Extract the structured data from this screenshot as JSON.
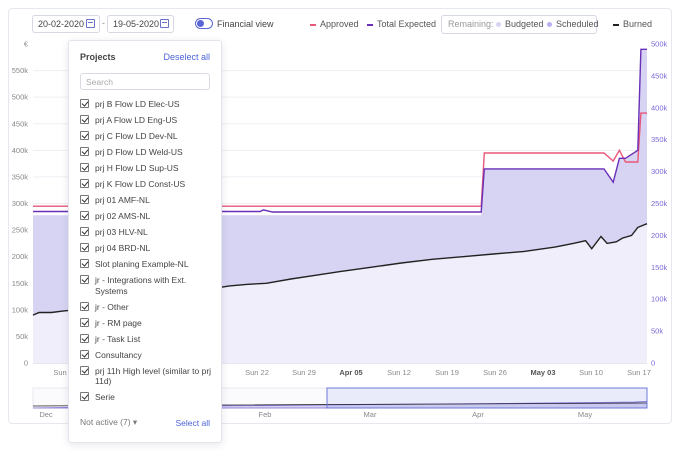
{
  "toolbar": {
    "date_from": "20-02-2020",
    "date_to": "19-05-2020",
    "date_separator": "-",
    "financial_view_label": "Financial view",
    "financial_view_on": true
  },
  "legend": {
    "approved": "Approved",
    "total_expected": "Total Expected",
    "remaining_label": "Remaining:",
    "budgeted": "Budgeted",
    "scheduled": "Scheduled",
    "burned": "Burned"
  },
  "colors": {
    "approved": "#e8587a",
    "total_expected": "#6a2fb8",
    "budgeted_area": "#d7d4f3",
    "scheduled_area": "#b8b0ef",
    "burned": "#222222",
    "accent": "#4b63d8"
  },
  "panel": {
    "title": "Projects",
    "deselect_all": "Deselect all",
    "search_placeholder": "Search",
    "items": [
      "prj B Flow LD Elec-US",
      "prj A Flow LD Eng-US",
      "prj C Flow LD Dev-NL",
      "prj D Flow LD Weld-US",
      "prj H Flow LD Sup-US",
      "prj K Flow LD Const-US",
      "prj 01 AMF-NL",
      "prj 02 AMS-NL",
      "prj 03 HLV-NL",
      "prj 04 BRD-NL",
      "Slot planing Example-NL",
      "jr - Integrations with Ext. Systems",
      "jr - Other",
      "jr - RM page",
      "jr - Task List",
      "Consultancy",
      "prj 11h High level (similar to prj 11d)",
      "Serie"
    ],
    "not_active": "Not active (7)",
    "select_all": "Select all"
  },
  "chart_data": {
    "type": "area",
    "y_unit_label": "€",
    "y_ticks": [
      "0",
      "50k",
      "100k",
      "150k",
      "200k",
      "250k",
      "300k",
      "350k",
      "400k",
      "450k",
      "500k",
      "550k"
    ],
    "y_ticks_right": [
      "0",
      "50k",
      "100k",
      "150k",
      "200k",
      "250k",
      "300k",
      "350k",
      "400k",
      "450k",
      "500k"
    ],
    "ylim": [
      0,
      600000
    ],
    "x_ticks": [
      {
        "label": "Sun",
        "bold": false
      },
      {
        "label": "Sun 22",
        "bold": false
      },
      {
        "label": "Sun 29",
        "bold": false
      },
      {
        "label": "Apr 05",
        "bold": true
      },
      {
        "label": "Sun 12",
        "bold": false
      },
      {
        "label": "Sun 19",
        "bold": false
      },
      {
        "label": "Sun 26",
        "bold": false
      },
      {
        "label": "May 03",
        "bold": true
      },
      {
        "label": "Sun 10",
        "bold": false
      },
      {
        "label": "Sun 17",
        "bold": false
      }
    ],
    "navigator_labels": [
      "Dec",
      "Feb",
      "Mar",
      "Apr",
      "May"
    ],
    "series": [
      {
        "name": "Approved",
        "kind": "line",
        "points": [
          [
            0,
            295000
          ],
          [
            0.73,
            295000
          ],
          [
            0.735,
            395000
          ],
          [
            0.93,
            395000
          ],
          [
            0.945,
            380000
          ],
          [
            0.955,
            400000
          ],
          [
            0.965,
            378000
          ],
          [
            0.985,
            378000
          ],
          [
            0.99,
            470000
          ],
          [
            1,
            470000
          ]
        ]
      },
      {
        "name": "Total Expected",
        "kind": "line",
        "points": [
          [
            0,
            285000
          ],
          [
            0.37,
            285000
          ],
          [
            0.375,
            288000
          ],
          [
            0.39,
            284000
          ],
          [
            0.73,
            284000
          ],
          [
            0.735,
            365000
          ],
          [
            0.93,
            365000
          ],
          [
            0.945,
            340000
          ],
          [
            0.955,
            385000
          ],
          [
            0.965,
            385000
          ],
          [
            0.985,
            400000
          ],
          [
            0.99,
            590000
          ],
          [
            1,
            590000
          ]
        ]
      },
      {
        "name": "Budgeted",
        "kind": "area",
        "points": [
          [
            0,
            278000
          ],
          [
            0.73,
            278000
          ],
          [
            0.735,
            365000
          ],
          [
            0.93,
            365000
          ],
          [
            0.945,
            340000
          ],
          [
            0.955,
            385000
          ],
          [
            0.965,
            385000
          ],
          [
            0.985,
            400000
          ],
          [
            0.99,
            590000
          ],
          [
            1,
            590000
          ]
        ]
      },
      {
        "name": "Burned",
        "kind": "line",
        "points": [
          [
            0,
            90000
          ],
          [
            0.01,
            95000
          ],
          [
            0.03,
            95000
          ],
          [
            0.05,
            98000
          ],
          [
            0.07,
            100000
          ],
          [
            0.32,
            145000
          ],
          [
            0.35,
            148000
          ],
          [
            0.38,
            150000
          ],
          [
            0.42,
            158000
          ],
          [
            0.46,
            165000
          ],
          [
            0.5,
            172000
          ],
          [
            0.55,
            180000
          ],
          [
            0.6,
            188000
          ],
          [
            0.65,
            195000
          ],
          [
            0.7,
            200000
          ],
          [
            0.75,
            205000
          ],
          [
            0.8,
            210000
          ],
          [
            0.85,
            218000
          ],
          [
            0.88,
            225000
          ],
          [
            0.9,
            230000
          ],
          [
            0.91,
            215000
          ],
          [
            0.925,
            238000
          ],
          [
            0.935,
            225000
          ],
          [
            0.95,
            228000
          ],
          [
            0.96,
            235000
          ],
          [
            0.975,
            240000
          ],
          [
            0.985,
            255000
          ],
          [
            1,
            262000
          ]
        ]
      }
    ]
  }
}
